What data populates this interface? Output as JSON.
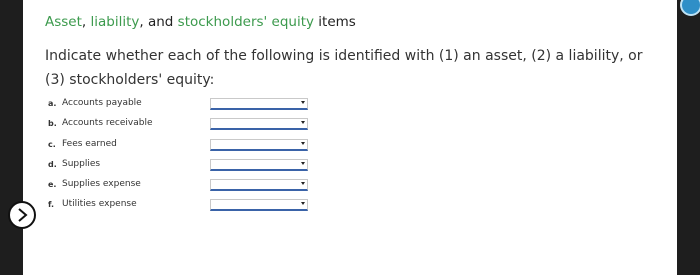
{
  "header": {
    "title_terms": [
      "Asset",
      "liability",
      "stockholders' equity"
    ],
    "title_sep1": ", ",
    "title_sep2": ", and ",
    "title_suffix": " items"
  },
  "instructions": "Indicate whether each of the following is identified with (1) an asset, (2) a liability, or (3) stockholders' equity:",
  "items": [
    {
      "letter": "a.",
      "label": "Accounts payable",
      "selected": ""
    },
    {
      "letter": "b.",
      "label": "Accounts receivable",
      "selected": ""
    },
    {
      "letter": "c.",
      "label": "Fees earned",
      "selected": ""
    },
    {
      "letter": "d.",
      "label": "Supplies",
      "selected": ""
    },
    {
      "letter": "e.",
      "label": "Supplies expense",
      "selected": ""
    },
    {
      "letter": "f.",
      "label": "Utilities expense",
      "selected": ""
    }
  ],
  "colors": {
    "term": "#3c9a4d",
    "select_underline": "#3a63a8",
    "nav_button_border": "#111111",
    "corner_icon": "#2f8fc7"
  },
  "icons": {
    "nav": "chevron-right-icon",
    "corner": "circle-icon",
    "dropdown": "dropdown-arrow-icon"
  }
}
